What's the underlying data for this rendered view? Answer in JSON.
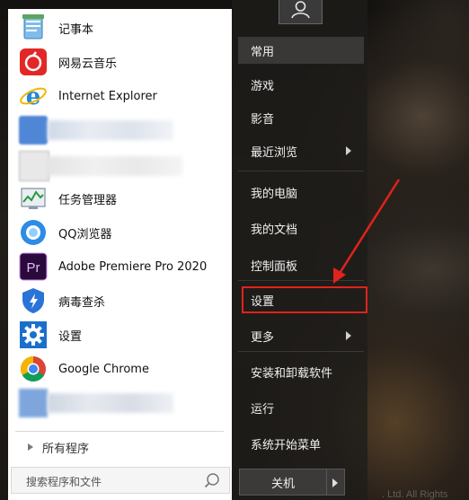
{
  "pinned_programs": [
    {
      "label": "记事本",
      "icon": "notepad-icon"
    },
    {
      "label": "网易云音乐",
      "icon": "netease-music-icon"
    },
    {
      "label": "Internet Explorer",
      "icon": "internet-explorer-icon"
    },
    {
      "label": "",
      "icon": "blurred-app-icon"
    },
    {
      "label": "",
      "icon": "blurred-file-icon"
    },
    {
      "label": "任务管理器",
      "icon": "task-manager-icon"
    },
    {
      "label": "QQ浏览器",
      "icon": "qq-browser-icon"
    },
    {
      "label": "Adobe Premiere Pro 2020",
      "icon": "premiere-pro-icon"
    },
    {
      "label": "病毒查杀",
      "icon": "antivirus-shield-icon"
    },
    {
      "label": "设置",
      "icon": "settings-gear-icon"
    },
    {
      "label": "Google Chrome",
      "icon": "google-chrome-icon"
    },
    {
      "label": "",
      "icon": "blurred-app-icon"
    }
  ],
  "all_programs": "所有程序",
  "search": {
    "placeholder": "搜索程序和文件"
  },
  "right_menu": {
    "frequent": "常用",
    "games": "游戏",
    "videos": "影音",
    "recent": "最近浏览",
    "computer": "我的电脑",
    "documents": "我的文档",
    "control_panel": "控制面板",
    "settings": "设置",
    "more": "更多",
    "install_uninstall": "安装和卸载软件",
    "run": "运行",
    "system_start_menu": "系统开始菜单"
  },
  "shutdown_label": "关机",
  "watermark": ". Ltd. All Rights",
  "annotation_color": "#e0231b"
}
